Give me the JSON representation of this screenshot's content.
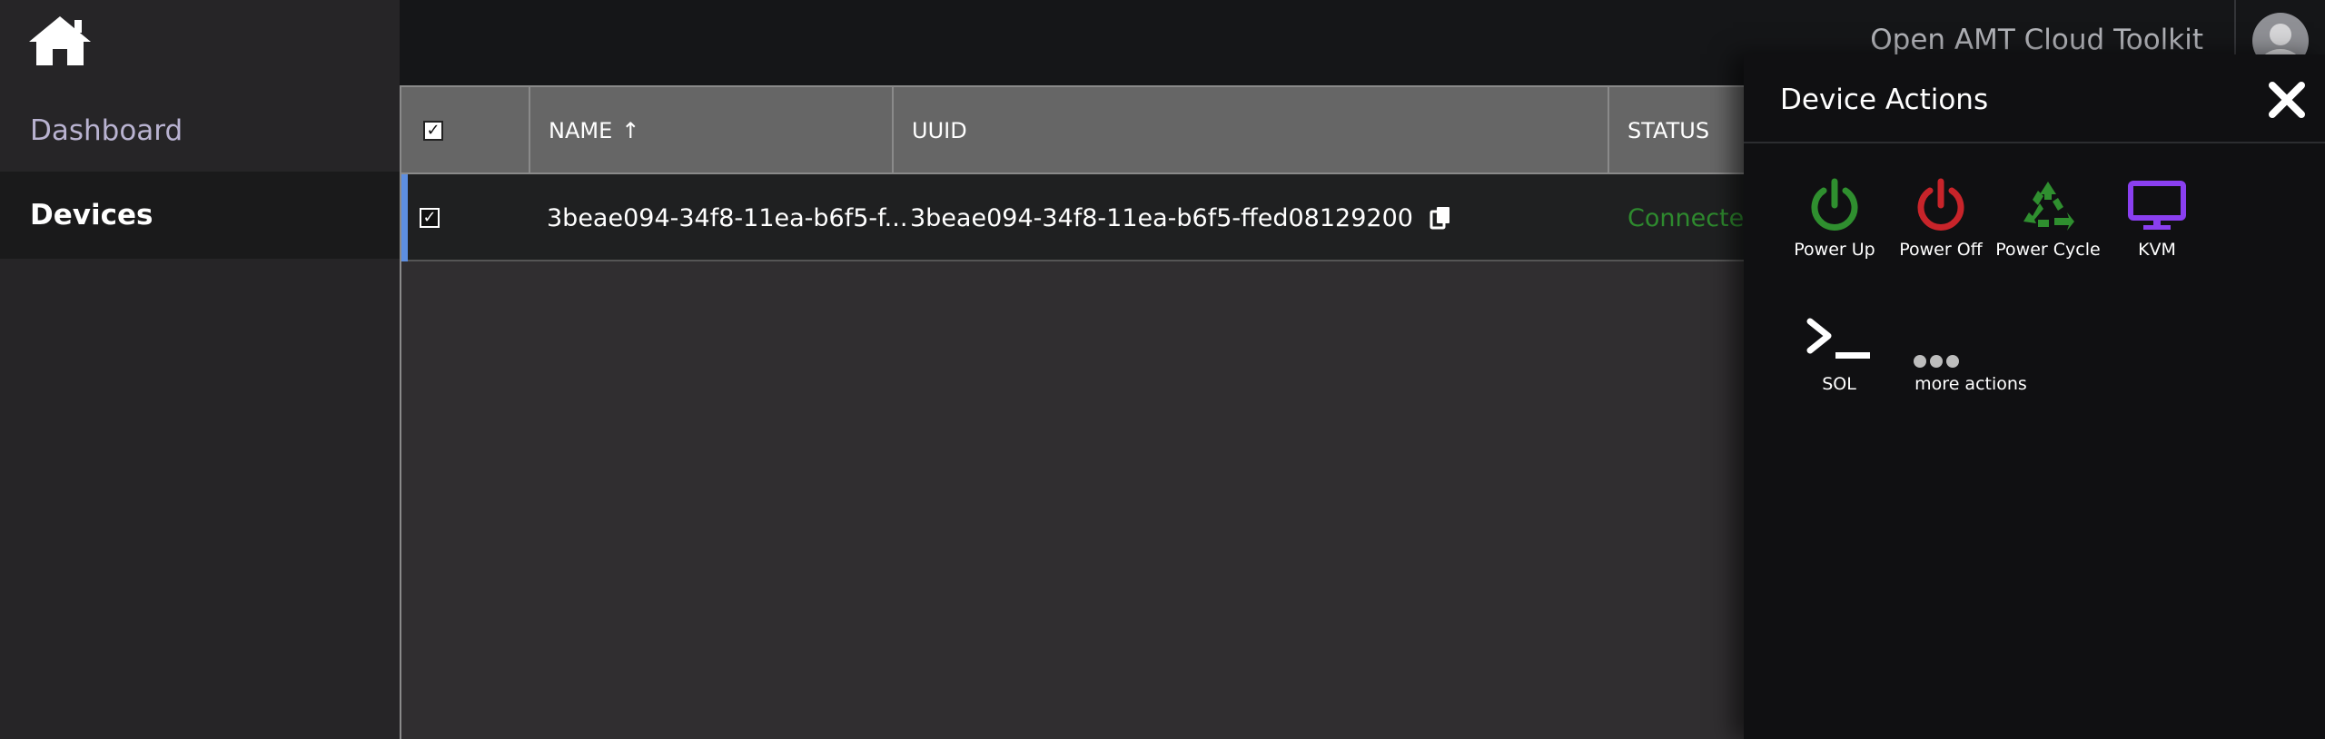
{
  "sidebar": {
    "home_icon": "home-icon",
    "items": [
      {
        "label": "Dashboard"
      },
      {
        "label": "Devices"
      }
    ]
  },
  "header": {
    "title": "Open AMT Cloud Toolkit",
    "avatar_icon": "user-avatar-icon"
  },
  "table": {
    "columns": [
      "NAME",
      "UUID",
      "STATUS"
    ],
    "sort_indicator": "↑",
    "header_checkbox": "✓",
    "rows": [
      {
        "checked": "✓",
        "name": "3beae094-34f8-11ea-b6f5-f...",
        "uuid": "3beae094-34f8-11ea-b6f5-ffed08129200",
        "status": "Connected"
      }
    ]
  },
  "drawer": {
    "title": "Device Actions",
    "close_icon": "close-icon",
    "actions": [
      {
        "label": "Power Up",
        "icon": "power-icon",
        "color": "#2f8f2f"
      },
      {
        "label": "Power Off",
        "icon": "power-icon",
        "color": "#c8242a"
      },
      {
        "label": "Power Cycle",
        "icon": "recycle-icon",
        "color": "#2f8f2f"
      },
      {
        "label": "KVM",
        "icon": "monitor-icon",
        "color": "#8a3ff0"
      },
      {
        "label": "SOL",
        "icon": "terminal-icon",
        "color": "#ffffff"
      },
      {
        "label": "more actions",
        "icon": "more-dots-icon",
        "color": "#bdbdbd"
      }
    ]
  },
  "colors": {
    "accent": "#5d8ee0",
    "status_connected": "#2e8a2e"
  }
}
